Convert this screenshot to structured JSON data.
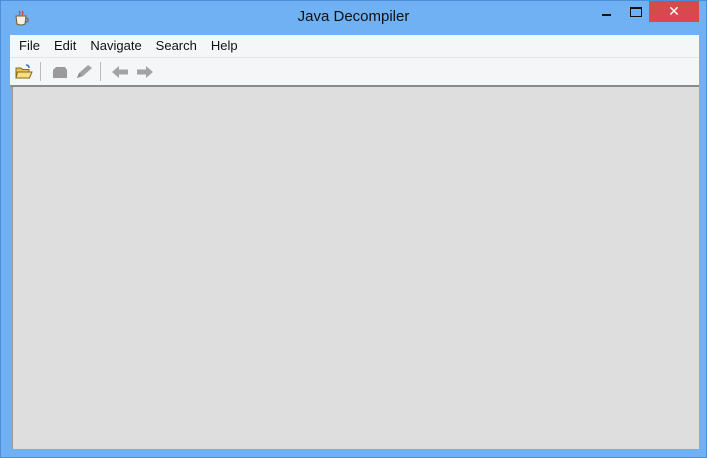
{
  "window": {
    "title": "Java Decompiler",
    "app_icon": "coffee-cup-icon",
    "controls": {
      "minimize_icon": "minimize-icon",
      "maximize_icon": "maximize-icon",
      "close_icon": "close-icon",
      "close_glyph": "✕",
      "close_color": "#d9474f"
    }
  },
  "menubar": {
    "items": [
      {
        "label": "File"
      },
      {
        "label": "Edit"
      },
      {
        "label": "Navigate"
      },
      {
        "label": "Search"
      },
      {
        "label": "Help"
      }
    ]
  },
  "toolbar": {
    "tools": [
      {
        "icon": "open-folder-icon",
        "enabled": true
      },
      {
        "icon": "open-type-icon",
        "enabled": false
      },
      {
        "icon": "edit-pencil-icon",
        "enabled": false
      },
      {
        "icon": "back-arrow-icon",
        "enabled": false
      },
      {
        "icon": "forward-arrow-icon",
        "enabled": false
      }
    ]
  },
  "colors": {
    "frame": "#6fb1f3",
    "content_background": "#dedede",
    "menubar_background": "#f5f6f7"
  }
}
